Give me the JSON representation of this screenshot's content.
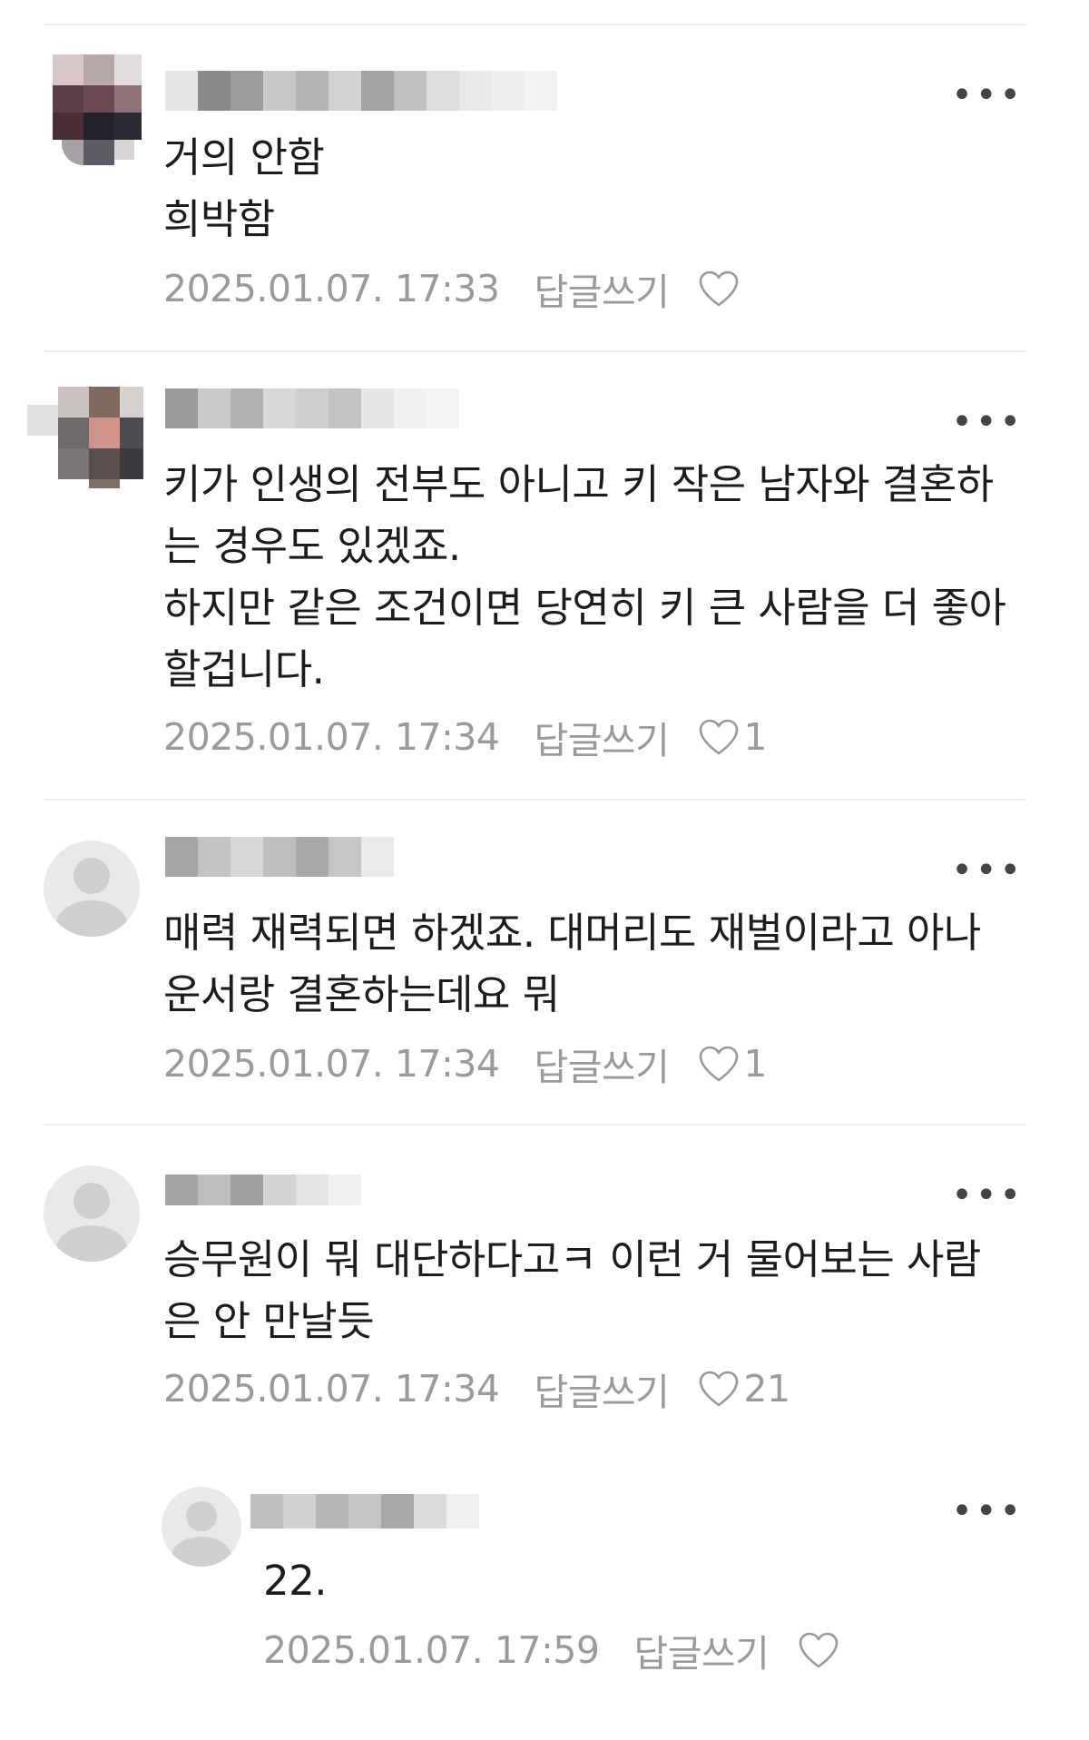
{
  "comments": [
    {
      "content": "거의 안함\n희박함",
      "date": "2025.01.07. 17:33",
      "reply_label": "답글쓰기",
      "like_count": "",
      "avatar": "mosaic-dark",
      "more_label": "•••"
    },
    {
      "content": "키가 인생의 전부도 아니고 키 작은 남자와 결혼하\n는 경우도 있겠죠.\n하지만 같은 조건이면 당연히 키 큰 사람을 더 좋아\n할겁니다.",
      "date": "2025.01.07. 17:34",
      "reply_label": "답글쓰기",
      "like_count": "1",
      "avatar": "mosaic-photo",
      "more_label": "•••"
    },
    {
      "content": "매력 재력되면 하겠죠. 대머리도 재벌이라고 아나\n운서랑 결혼하는데요 뭐",
      "date": "2025.01.07. 17:34",
      "reply_label": "답글쓰기",
      "like_count": "1",
      "avatar": "default",
      "more_label": "•••"
    },
    {
      "content": "승무원이 뭐 대단하다고ㅋ 이런 거 물어보는 사람\n은 안 만날듯",
      "date": "2025.01.07. 17:34",
      "reply_label": "답글쓰기",
      "like_count": "21",
      "avatar": "default",
      "more_label": "•••"
    },
    {
      "content": "22.",
      "date": "2025.01.07. 17:59",
      "reply_label": "답글쓰기",
      "like_count": "",
      "avatar": "default",
      "more_label": "•••",
      "is_reply": true
    }
  ],
  "colors": {
    "meta_text": "#9a9a9a",
    "divider": "#ececec",
    "body_text": "#1c1c1c"
  },
  "icons": {
    "like": "heart-outline-icon",
    "more": "more-dots-icon",
    "avatar_default": "default-user-avatar-icon"
  }
}
